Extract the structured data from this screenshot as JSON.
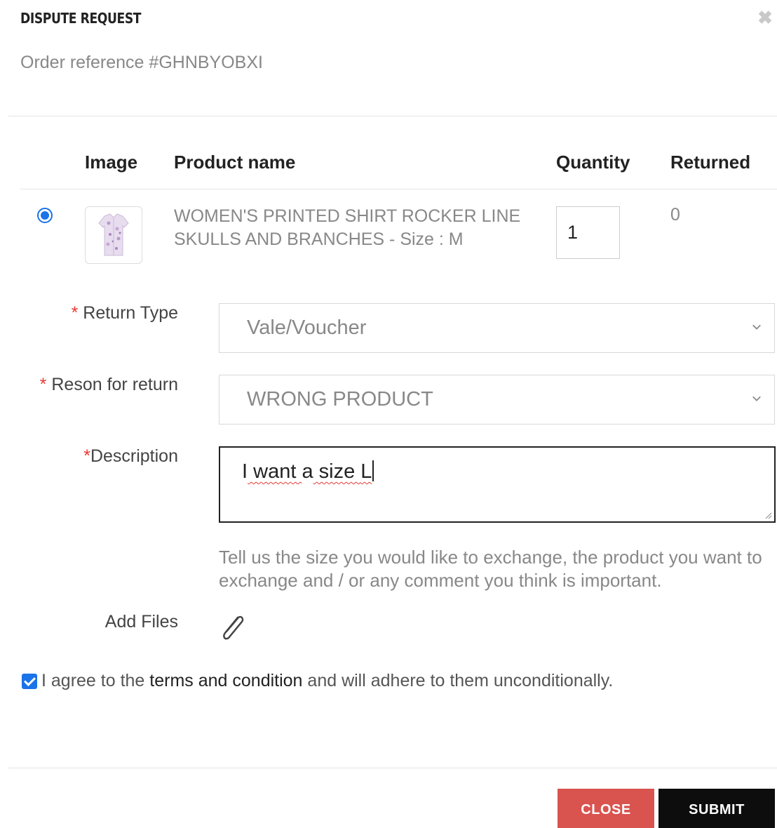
{
  "header": {
    "title": "DISPUTE REQUEST",
    "close_icon": "✖",
    "order_ref": "Order reference #GHNBYOBXI"
  },
  "table": {
    "columns": [
      "",
      "Image",
      "Product name",
      "Quantity",
      "Returned"
    ],
    "rows": [
      {
        "selected": true,
        "product_name": "WOMEN'S PRINTED SHIRT ROCKER LINE SKULLS AND BRANCHES - ",
        "size_text": "Size : M",
        "quantity": "1",
        "returned": "0"
      }
    ]
  },
  "form": {
    "return_type": {
      "label": "Return Type",
      "required_mark": "*",
      "value": "Vale/Voucher"
    },
    "reason": {
      "label": "Reson for return",
      "required_mark": "*",
      "value": "WRONG PRODUCT"
    },
    "description": {
      "label": "Description",
      "required_mark": "*",
      "value_words": [
        "I",
        " want ",
        "a",
        " size ",
        "L"
      ]
    },
    "help_text": "Tell us the size you would like to exchange, the product you want to exchange and / or any comment you think is important.",
    "add_files_label": "Add Files"
  },
  "agreement": {
    "checked": true,
    "before": "I agree to the ",
    "link": "terms and condition",
    "after": " and will adhere to them unconditionally."
  },
  "buttons": {
    "close": "CLOSE",
    "submit": "SUBMIT"
  },
  "colors": {
    "accent": "#1a73e8",
    "close_button": "#d9534f",
    "submit_button": "#0d0d0d",
    "required": "#e53935"
  }
}
